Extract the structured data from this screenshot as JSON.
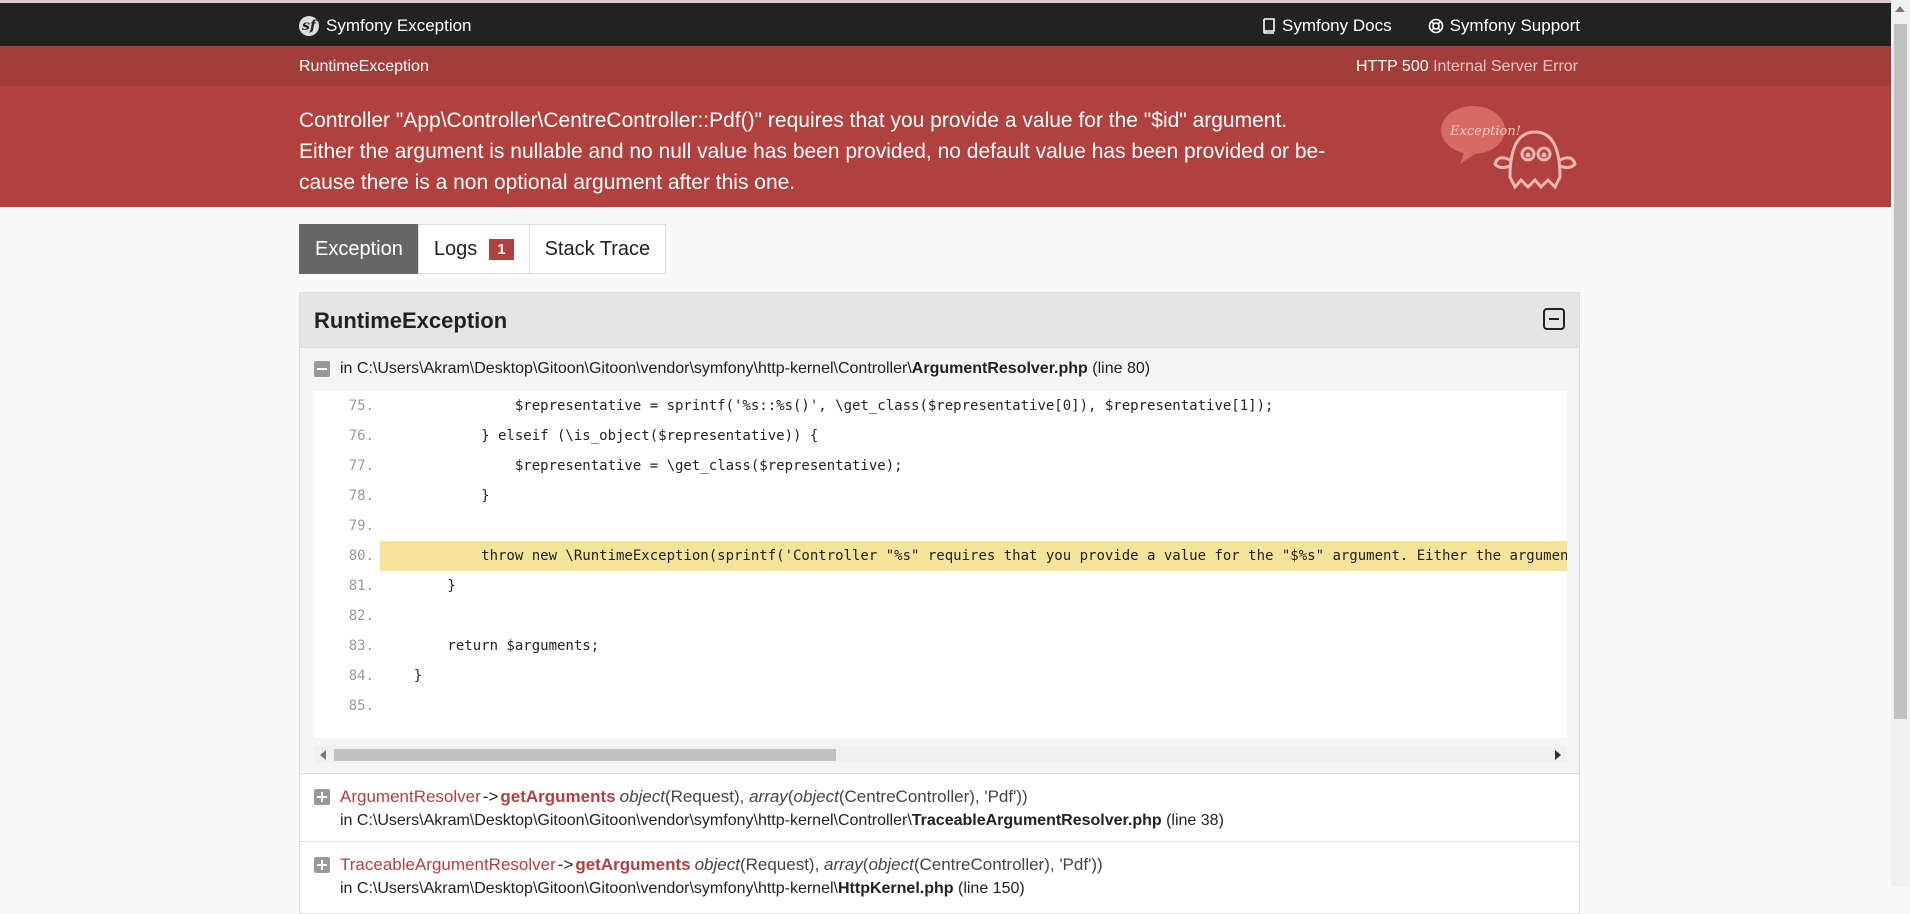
{
  "topbar": {
    "brand": "Symfony Exception",
    "docs": "Symfony Docs",
    "support": "Symfony Support"
  },
  "header": {
    "exception_class": "RuntimeException",
    "status_code": "HTTP 500",
    "status_text": "Internal Server Error",
    "message_lines": [
      "Controller \"App\\Controller\\CentreController::Pdf()\" requires that you provide a value for the \"$id\" argument.",
      "Either the argument is nullable and no null value has been provided, no default value has been provided or be-",
      "cause there is a non optional argument after this one."
    ],
    "mascot_text": "Exception!"
  },
  "tabs": [
    {
      "label": "Exception",
      "active": true
    },
    {
      "label": "Logs",
      "badge": "1"
    },
    {
      "label": "Stack Trace"
    }
  ],
  "panel": {
    "title": "RuntimeException",
    "file": {
      "prefix": "in C:\\Users\\Akram\\Desktop\\Gitoon\\Gitoon\\vendor\\symfony\\http-kernel\\Controller\\",
      "name": "ArgumentResolver.php",
      "line": "(line 80)"
    },
    "code_lines": [
      {
        "n": "75.",
        "code": "                $representative = sprintf('%s::%s()', \\get_class($representative[0]), $representative[1]);"
      },
      {
        "n": "76.",
        "code": "            } elseif (\\is_object($representative)) {"
      },
      {
        "n": "77.",
        "code": "                $representative = \\get_class($representative);"
      },
      {
        "n": "78.",
        "code": "            }"
      },
      {
        "n": "79.",
        "code": ""
      },
      {
        "n": "80.",
        "code": "            throw new \\RuntimeException(sprintf('Controller \"%s\" requires that you provide a value for the \"$%s\" argument. Either the argument is nullable",
        "highlight": true
      },
      {
        "n": "81.",
        "code": "        }"
      },
      {
        "n": "82.",
        "code": ""
      },
      {
        "n": "83.",
        "code": "        return $arguments;"
      },
      {
        "n": "84.",
        "code": "    }"
      },
      {
        "n": "85.",
        "code": ""
      }
    ],
    "trace": [
      {
        "class": "ArgumentResolver",
        "arrow": "->",
        "method": "getArguments",
        "args_html": [
          "object",
          "(Request), ",
          "array",
          "(",
          "object",
          "(CentreController), 'Pdf'))"
        ],
        "path": "in C:\\Users\\Akram\\Desktop\\Gitoon\\Gitoon\\vendor\\symfony\\http-kernel\\Controller\\",
        "file": "TraceableArgumentResolver.php",
        "line": "(line 38)"
      },
      {
        "class": "TraceableArgumentResolver",
        "arrow": "->",
        "method": "getArguments",
        "args_html": [
          "object",
          "(Request), ",
          "array",
          "(",
          "object",
          "(CentreController), 'Pdf'))"
        ],
        "path": "in C:\\Users\\Akram\\Desktop\\Gitoon\\Gitoon\\vendor\\symfony\\http-kernel\\",
        "file": "HttpKernel.php",
        "line": "(line 150)"
      }
    ]
  }
}
